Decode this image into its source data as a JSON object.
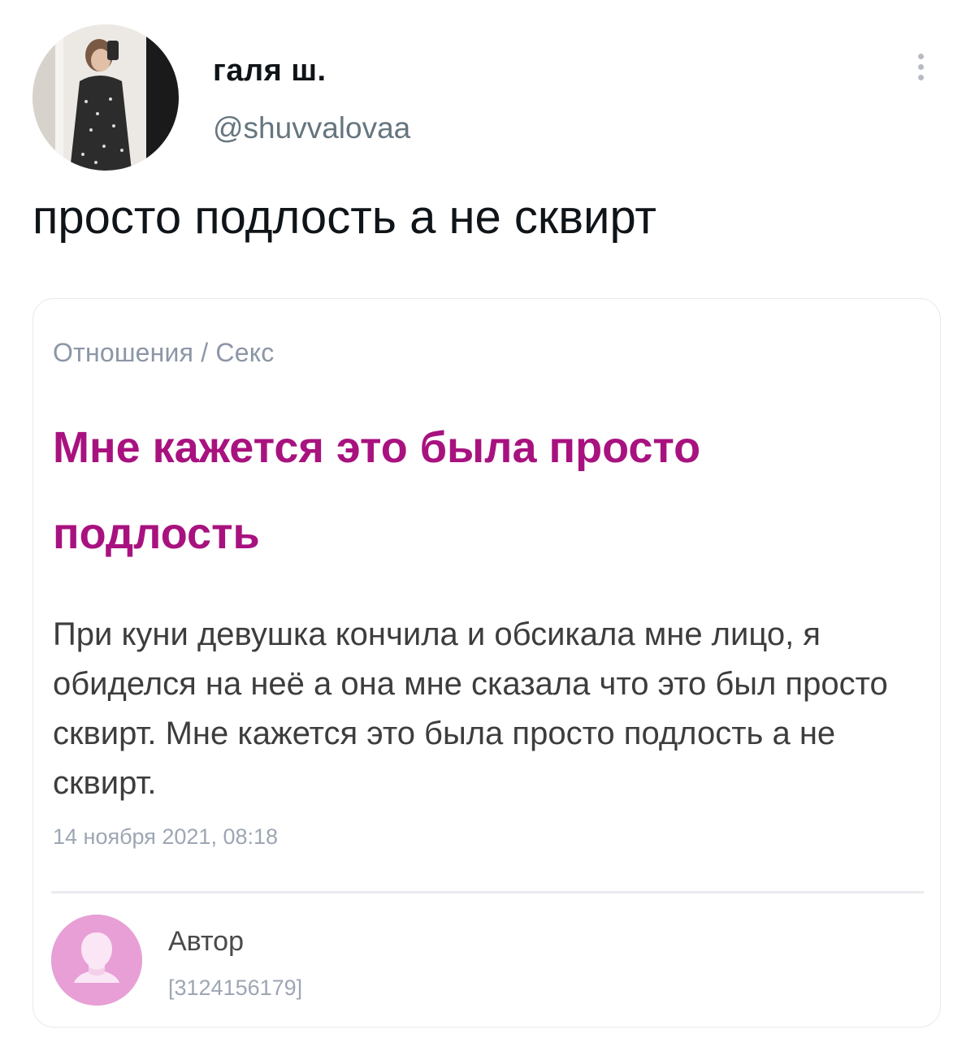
{
  "tweet": {
    "author": {
      "display_name": "галя ш.",
      "handle": "@shuvvalovaa",
      "avatar_icon": "user-photo-avatar"
    },
    "more_icon": "vertical-ellipsis-icon",
    "text": "просто подлость а не сквирт"
  },
  "article": {
    "breadcrumb": "Отношения / Секс",
    "title": "Мне кажется это была просто подлость",
    "body": "При куни девушка кончила и обсикала мне лицо, я обиделся на неё а она мне сказала что это был просто сквирт. Мне кажется это была просто подлость а не сквирт.",
    "date": "14 ноября 2021, 08:18",
    "author": {
      "label": "Автор",
      "id": "[3124156179]",
      "avatar_icon": "anonymous-user-icon"
    }
  },
  "colors": {
    "title_accent": "#a8127f",
    "author_avatar_bg": "#e89fd6",
    "muted_text": "#9da6b3"
  }
}
